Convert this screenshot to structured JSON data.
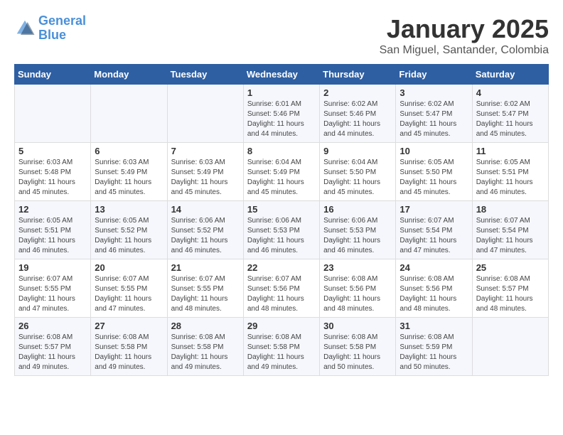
{
  "logo": {
    "line1": "General",
    "line2": "Blue"
  },
  "title": "January 2025",
  "subtitle": "San Miguel, Santander, Colombia",
  "days_of_week": [
    "Sunday",
    "Monday",
    "Tuesday",
    "Wednesday",
    "Thursday",
    "Friday",
    "Saturday"
  ],
  "weeks": [
    [
      {
        "day": "",
        "info": ""
      },
      {
        "day": "",
        "info": ""
      },
      {
        "day": "",
        "info": ""
      },
      {
        "day": "1",
        "info": "Sunrise: 6:01 AM\nSunset: 5:46 PM\nDaylight: 11 hours\nand 44 minutes."
      },
      {
        "day": "2",
        "info": "Sunrise: 6:02 AM\nSunset: 5:46 PM\nDaylight: 11 hours\nand 44 minutes."
      },
      {
        "day": "3",
        "info": "Sunrise: 6:02 AM\nSunset: 5:47 PM\nDaylight: 11 hours\nand 45 minutes."
      },
      {
        "day": "4",
        "info": "Sunrise: 6:02 AM\nSunset: 5:47 PM\nDaylight: 11 hours\nand 45 minutes."
      }
    ],
    [
      {
        "day": "5",
        "info": "Sunrise: 6:03 AM\nSunset: 5:48 PM\nDaylight: 11 hours\nand 45 minutes."
      },
      {
        "day": "6",
        "info": "Sunrise: 6:03 AM\nSunset: 5:49 PM\nDaylight: 11 hours\nand 45 minutes."
      },
      {
        "day": "7",
        "info": "Sunrise: 6:03 AM\nSunset: 5:49 PM\nDaylight: 11 hours\nand 45 minutes."
      },
      {
        "day": "8",
        "info": "Sunrise: 6:04 AM\nSunset: 5:49 PM\nDaylight: 11 hours\nand 45 minutes."
      },
      {
        "day": "9",
        "info": "Sunrise: 6:04 AM\nSunset: 5:50 PM\nDaylight: 11 hours\nand 45 minutes."
      },
      {
        "day": "10",
        "info": "Sunrise: 6:05 AM\nSunset: 5:50 PM\nDaylight: 11 hours\nand 45 minutes."
      },
      {
        "day": "11",
        "info": "Sunrise: 6:05 AM\nSunset: 5:51 PM\nDaylight: 11 hours\nand 46 minutes."
      }
    ],
    [
      {
        "day": "12",
        "info": "Sunrise: 6:05 AM\nSunset: 5:51 PM\nDaylight: 11 hours\nand 46 minutes."
      },
      {
        "day": "13",
        "info": "Sunrise: 6:05 AM\nSunset: 5:52 PM\nDaylight: 11 hours\nand 46 minutes."
      },
      {
        "day": "14",
        "info": "Sunrise: 6:06 AM\nSunset: 5:52 PM\nDaylight: 11 hours\nand 46 minutes."
      },
      {
        "day": "15",
        "info": "Sunrise: 6:06 AM\nSunset: 5:53 PM\nDaylight: 11 hours\nand 46 minutes."
      },
      {
        "day": "16",
        "info": "Sunrise: 6:06 AM\nSunset: 5:53 PM\nDaylight: 11 hours\nand 46 minutes."
      },
      {
        "day": "17",
        "info": "Sunrise: 6:07 AM\nSunset: 5:54 PM\nDaylight: 11 hours\nand 47 minutes."
      },
      {
        "day": "18",
        "info": "Sunrise: 6:07 AM\nSunset: 5:54 PM\nDaylight: 11 hours\nand 47 minutes."
      }
    ],
    [
      {
        "day": "19",
        "info": "Sunrise: 6:07 AM\nSunset: 5:55 PM\nDaylight: 11 hours\nand 47 minutes."
      },
      {
        "day": "20",
        "info": "Sunrise: 6:07 AM\nSunset: 5:55 PM\nDaylight: 11 hours\nand 47 minutes."
      },
      {
        "day": "21",
        "info": "Sunrise: 6:07 AM\nSunset: 5:55 PM\nDaylight: 11 hours\nand 48 minutes."
      },
      {
        "day": "22",
        "info": "Sunrise: 6:07 AM\nSunset: 5:56 PM\nDaylight: 11 hours\nand 48 minutes."
      },
      {
        "day": "23",
        "info": "Sunrise: 6:08 AM\nSunset: 5:56 PM\nDaylight: 11 hours\nand 48 minutes."
      },
      {
        "day": "24",
        "info": "Sunrise: 6:08 AM\nSunset: 5:56 PM\nDaylight: 11 hours\nand 48 minutes."
      },
      {
        "day": "25",
        "info": "Sunrise: 6:08 AM\nSunset: 5:57 PM\nDaylight: 11 hours\nand 48 minutes."
      }
    ],
    [
      {
        "day": "26",
        "info": "Sunrise: 6:08 AM\nSunset: 5:57 PM\nDaylight: 11 hours\nand 49 minutes."
      },
      {
        "day": "27",
        "info": "Sunrise: 6:08 AM\nSunset: 5:58 PM\nDaylight: 11 hours\nand 49 minutes."
      },
      {
        "day": "28",
        "info": "Sunrise: 6:08 AM\nSunset: 5:58 PM\nDaylight: 11 hours\nand 49 minutes."
      },
      {
        "day": "29",
        "info": "Sunrise: 6:08 AM\nSunset: 5:58 PM\nDaylight: 11 hours\nand 49 minutes."
      },
      {
        "day": "30",
        "info": "Sunrise: 6:08 AM\nSunset: 5:58 PM\nDaylight: 11 hours\nand 50 minutes."
      },
      {
        "day": "31",
        "info": "Sunrise: 6:08 AM\nSunset: 5:59 PM\nDaylight: 11 hours\nand 50 minutes."
      },
      {
        "day": "",
        "info": ""
      }
    ]
  ]
}
